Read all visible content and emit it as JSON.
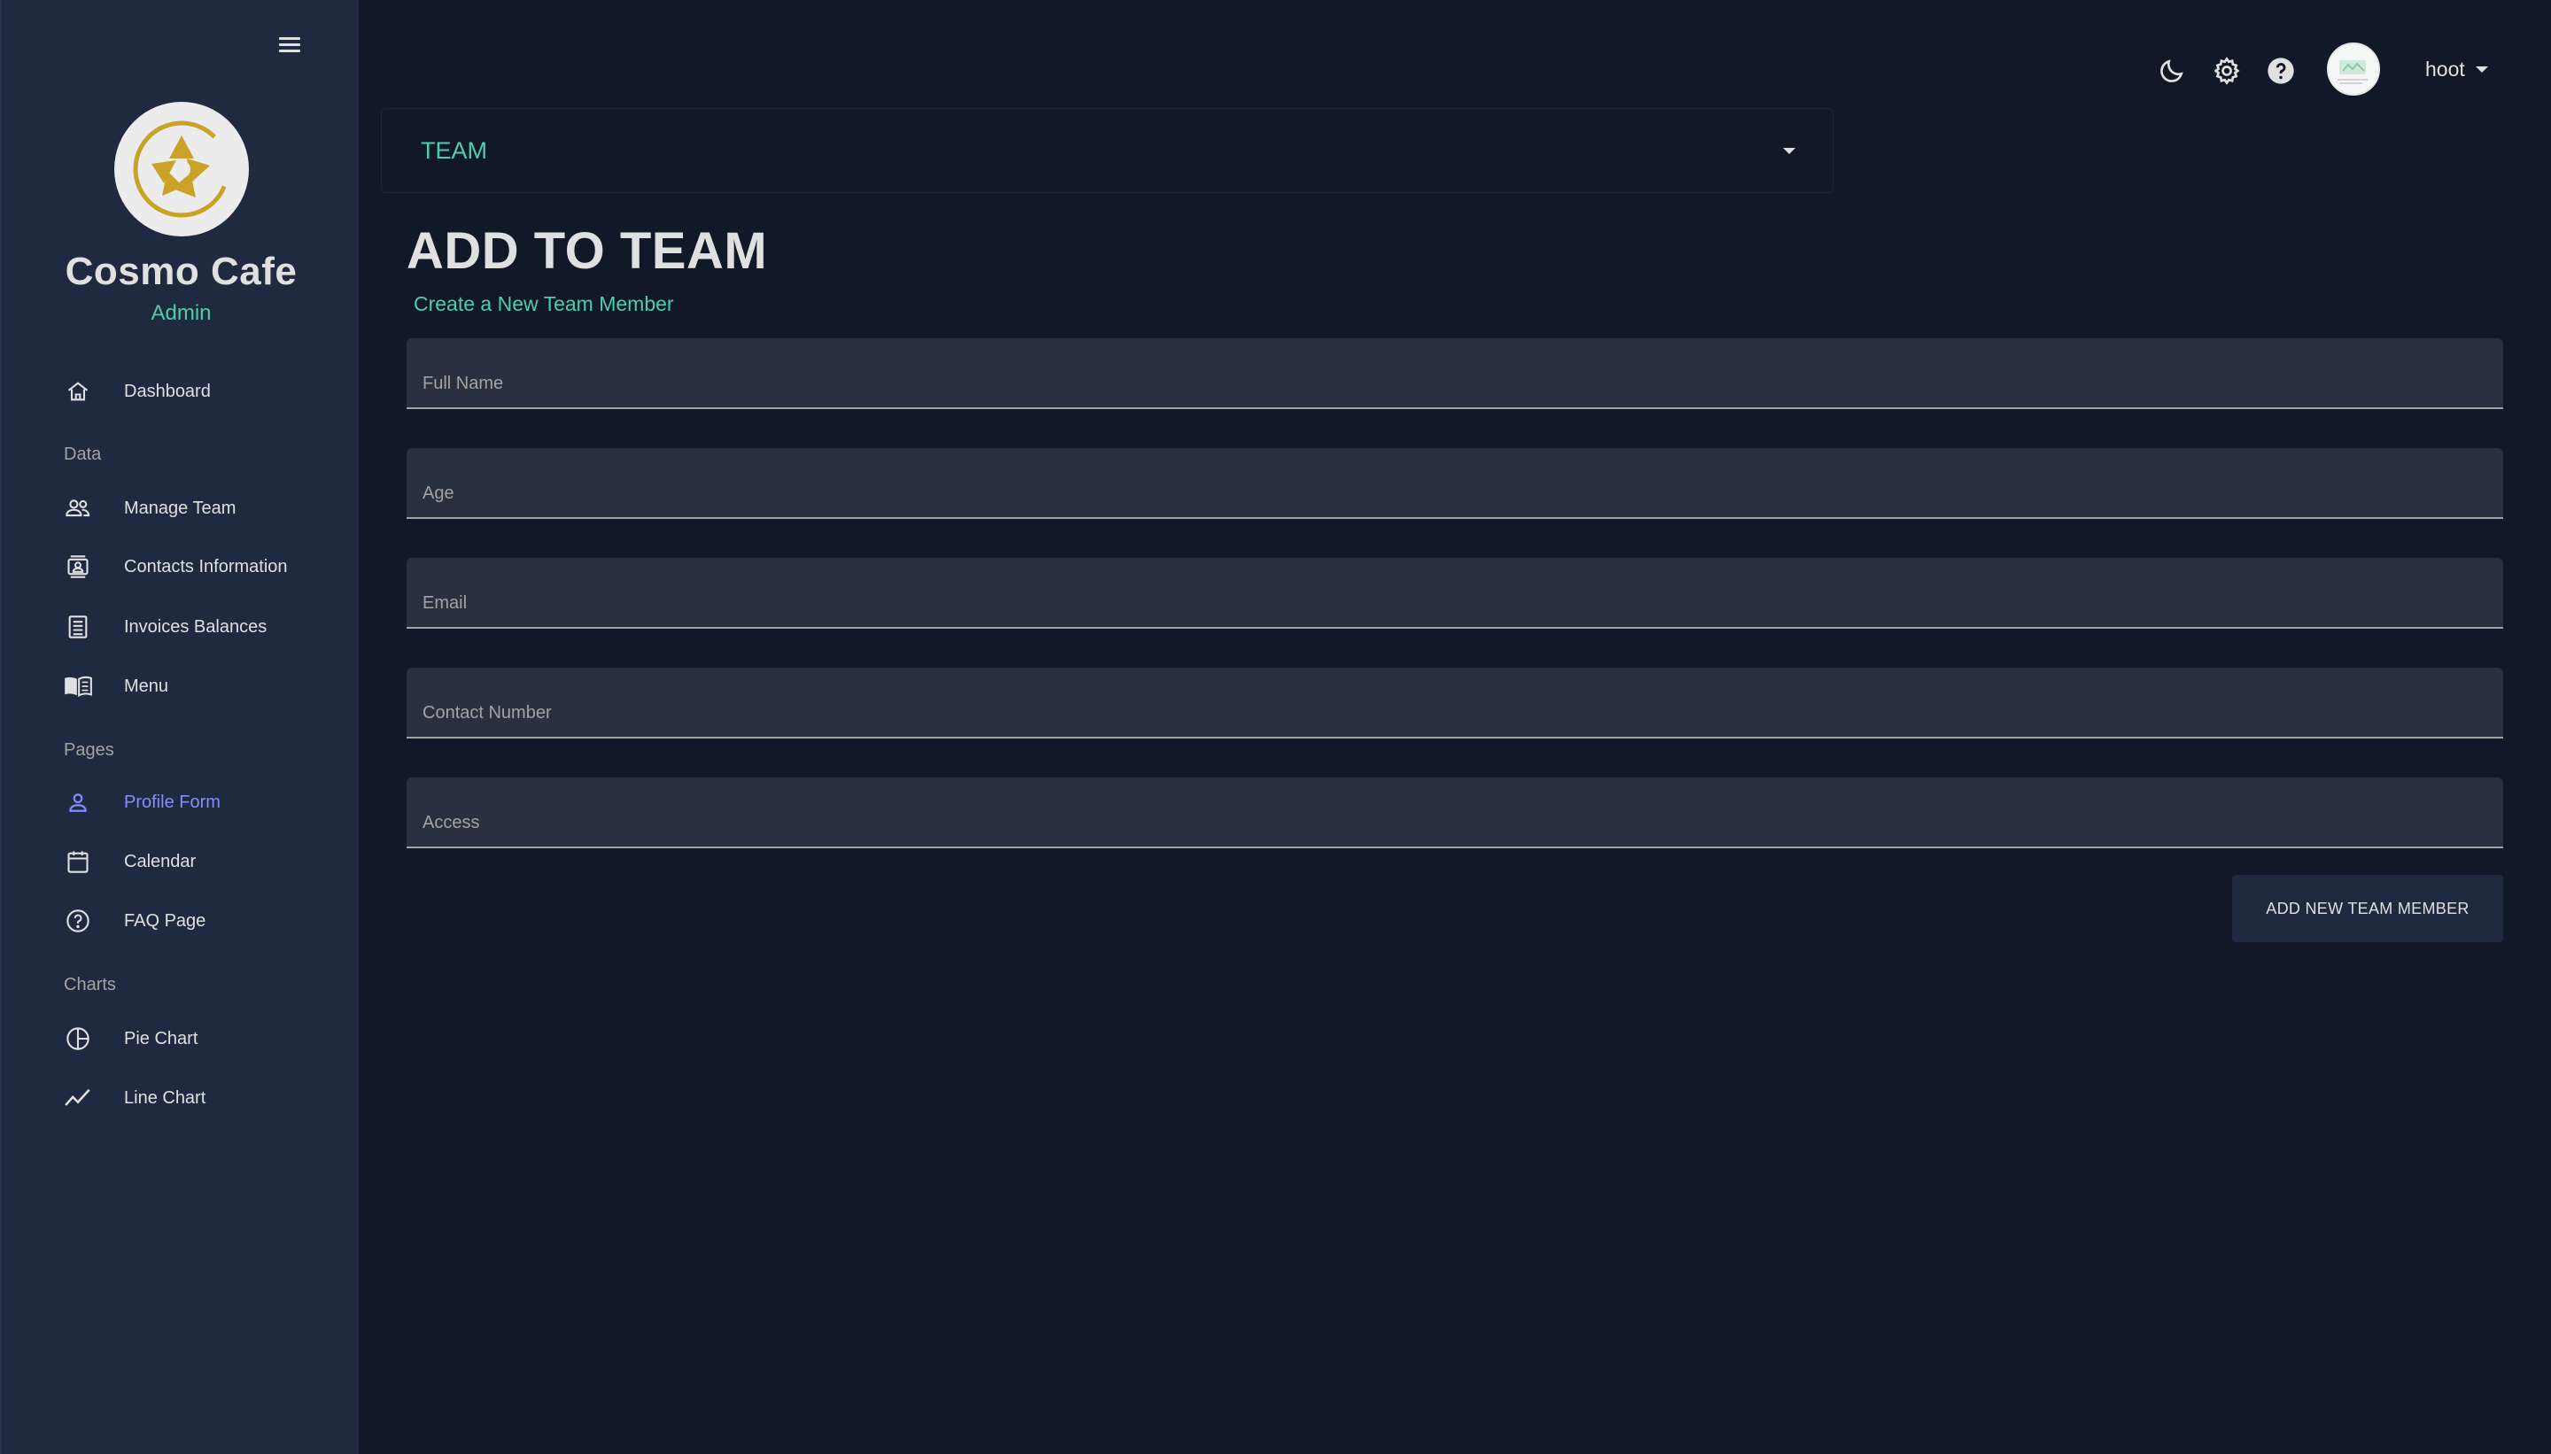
{
  "sidebar": {
    "brand_name": "Cosmo Cafe",
    "brand_role": "Admin",
    "sections": {
      "data": "Data",
      "pages": "Pages",
      "charts": "Charts"
    },
    "items": {
      "dashboard": "Dashboard",
      "manage_team": "Manage Team",
      "contacts": "Contacts Information",
      "invoices": "Invoices Balances",
      "menu": "Menu",
      "profile_form": "Profile Form",
      "calendar": "Calendar",
      "faq": "FAQ Page",
      "pie_chart": "Pie Chart",
      "line_chart": "Line Chart"
    },
    "active_item": "profile_form"
  },
  "topbar": {
    "user_name": "hoot",
    "icons": [
      "moon-icon",
      "gear-icon",
      "help-icon"
    ]
  },
  "team_select": {
    "value": "TEAM"
  },
  "header": {
    "title": "ADD TO TEAM",
    "subtitle": "Create a New Team Member"
  },
  "form": {
    "full_name": "Full Name",
    "age": "Age",
    "email": "Email",
    "contact_number": "Contact Number",
    "access": "Access",
    "submit_label": "ADD NEW TEAM MEMBER"
  },
  "colors": {
    "background": "#111827",
    "sidebar": "#1f2a40",
    "accent_green": "#4cceac",
    "accent_purple": "#868dfb",
    "logo_gold": "#c9a227"
  }
}
